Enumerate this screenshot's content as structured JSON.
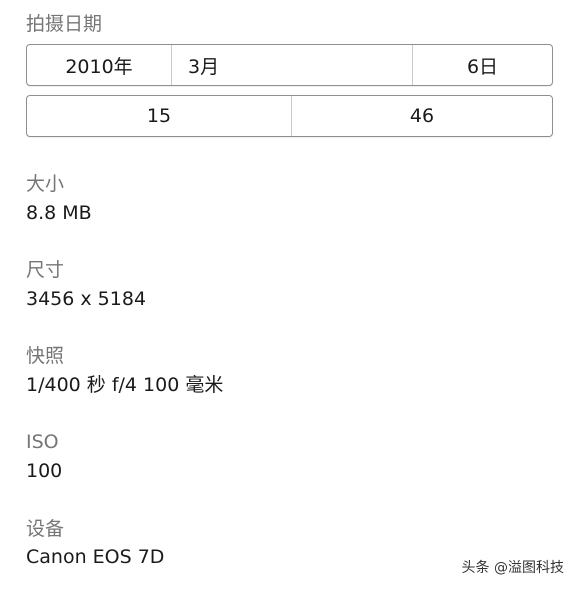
{
  "date_taken": {
    "label": "拍摄日期",
    "year": "2010年",
    "month": "3月",
    "day": "6日",
    "hour": "15",
    "minute": "46"
  },
  "size": {
    "label": "大小",
    "value": "8.8 MB"
  },
  "dimensions": {
    "label": "尺寸",
    "value": "3456 x 5184"
  },
  "shutter": {
    "label": "快照",
    "value": "1/400 秒 f/4 100 毫米"
  },
  "iso": {
    "label": "ISO",
    "value": "100"
  },
  "device": {
    "label": "设备",
    "value": "Canon EOS 7D"
  },
  "watermark": "头条 @溢图科技"
}
